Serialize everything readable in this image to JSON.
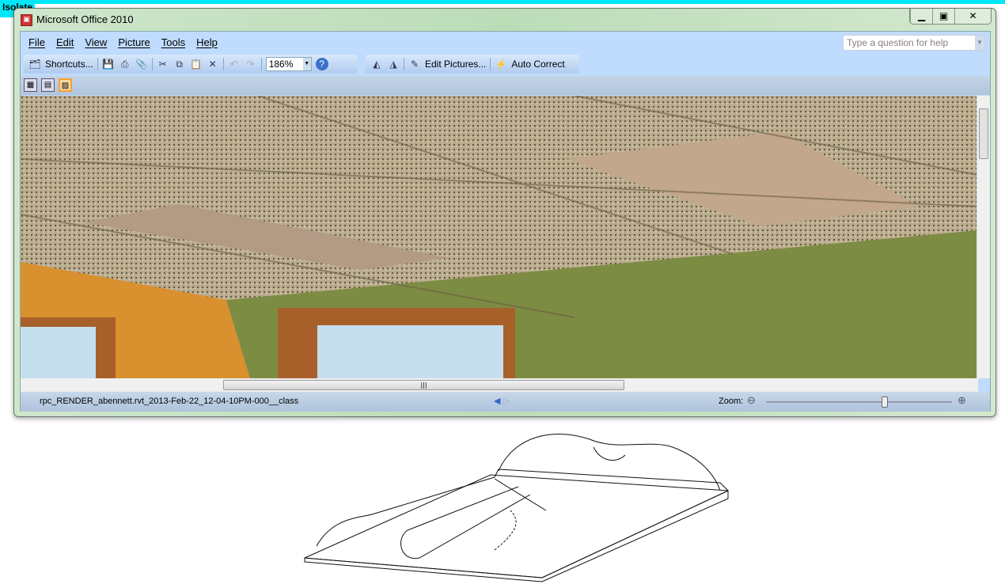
{
  "overlay_label": "Isolate",
  "window": {
    "title": "Microsoft Office 2010",
    "app_icon": "picture-manager-icon",
    "controls": [
      "minimize",
      "restore",
      "close"
    ]
  },
  "menu": [
    "File",
    "Edit",
    "View",
    "Picture",
    "Tools",
    "Help"
  ],
  "help_box": {
    "placeholder": "Type a question for help"
  },
  "toolbar": {
    "shortcuts": "Shortcuts...",
    "zoom_value": "186%",
    "edit_pictures": "Edit Pictures...",
    "auto_correct": "Auto Correct"
  },
  "status": {
    "filename": "rpc_RENDER_abennett.rvt_2013-Feb-22_12-04-10PM-000__class",
    "zoom_label": "Zoom:",
    "zoom_slider_fraction": 0.64
  }
}
